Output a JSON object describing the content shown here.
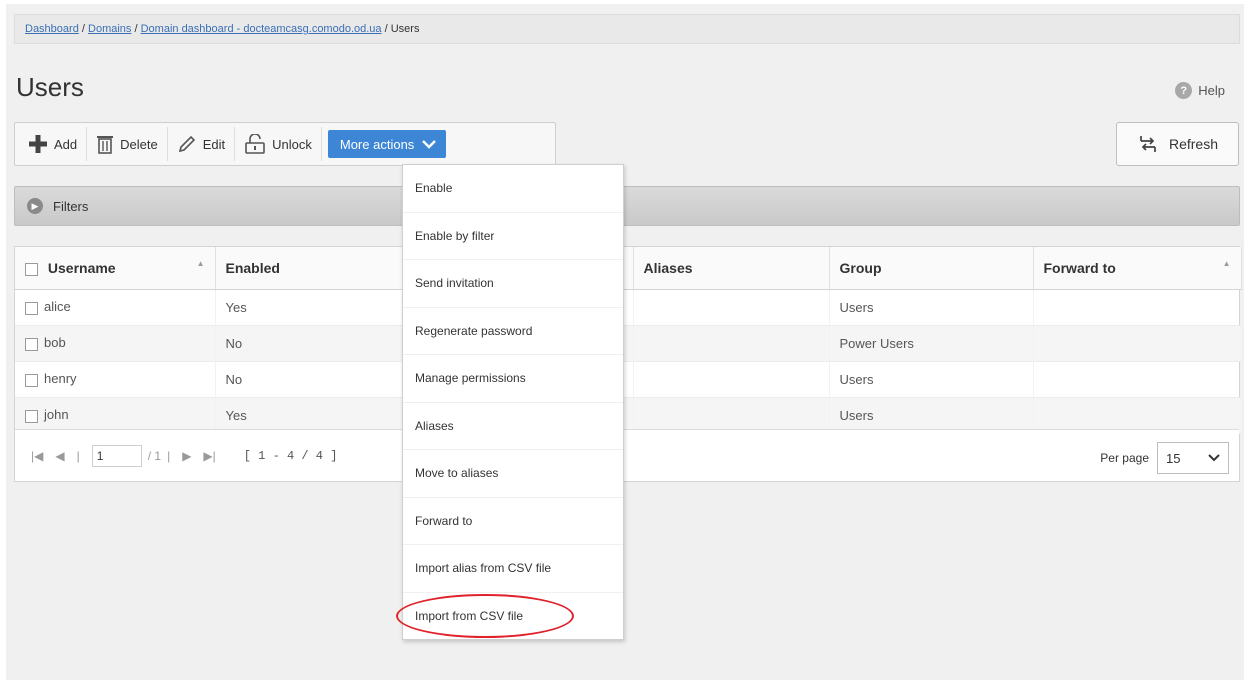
{
  "breadcrumb": {
    "items": [
      "Dashboard",
      "Domains",
      "Domain dashboard - docteamcasg.comodo.od.ua",
      "Users"
    ],
    "separator": "/"
  },
  "page": {
    "title": "Users",
    "help_label": "Help"
  },
  "toolbar": {
    "add_label": "Add",
    "delete_label": "Delete",
    "edit_label": "Edit",
    "unlock_label": "Unlock",
    "more_actions_label": "More actions",
    "refresh_label": "Refresh"
  },
  "filters": {
    "label": "Filters"
  },
  "table": {
    "columns": [
      "Username",
      "Enabled",
      "Aliases",
      "Group",
      "Forward to"
    ],
    "rows": [
      {
        "username": "alice",
        "enabled": "Yes",
        "group": "Users"
      },
      {
        "username": "bob",
        "enabled": "No",
        "group": "Power Users"
      },
      {
        "username": "henry",
        "enabled": "No",
        "group": "Users"
      },
      {
        "username": "john",
        "enabled": "Yes",
        "group": "Users"
      }
    ]
  },
  "pager": {
    "page_value": "1",
    "total_pages": "/ 1",
    "range": "[ 1 - 4 / 4 ]",
    "per_page_label": "Per page",
    "per_page_value": "15"
  },
  "more_actions_menu": {
    "items": [
      "Enable",
      "Enable by filter",
      "Send invitation",
      "Regenerate password",
      "Manage permissions",
      "Aliases",
      "Move to aliases",
      "Forward to",
      "Import alias from CSV file",
      "Import from CSV file"
    ],
    "highlighted": "Import from CSV file"
  },
  "colors": {
    "accent": "#3c86d5",
    "link": "#3a6fb7",
    "highlight_circle": "#e0222a"
  }
}
